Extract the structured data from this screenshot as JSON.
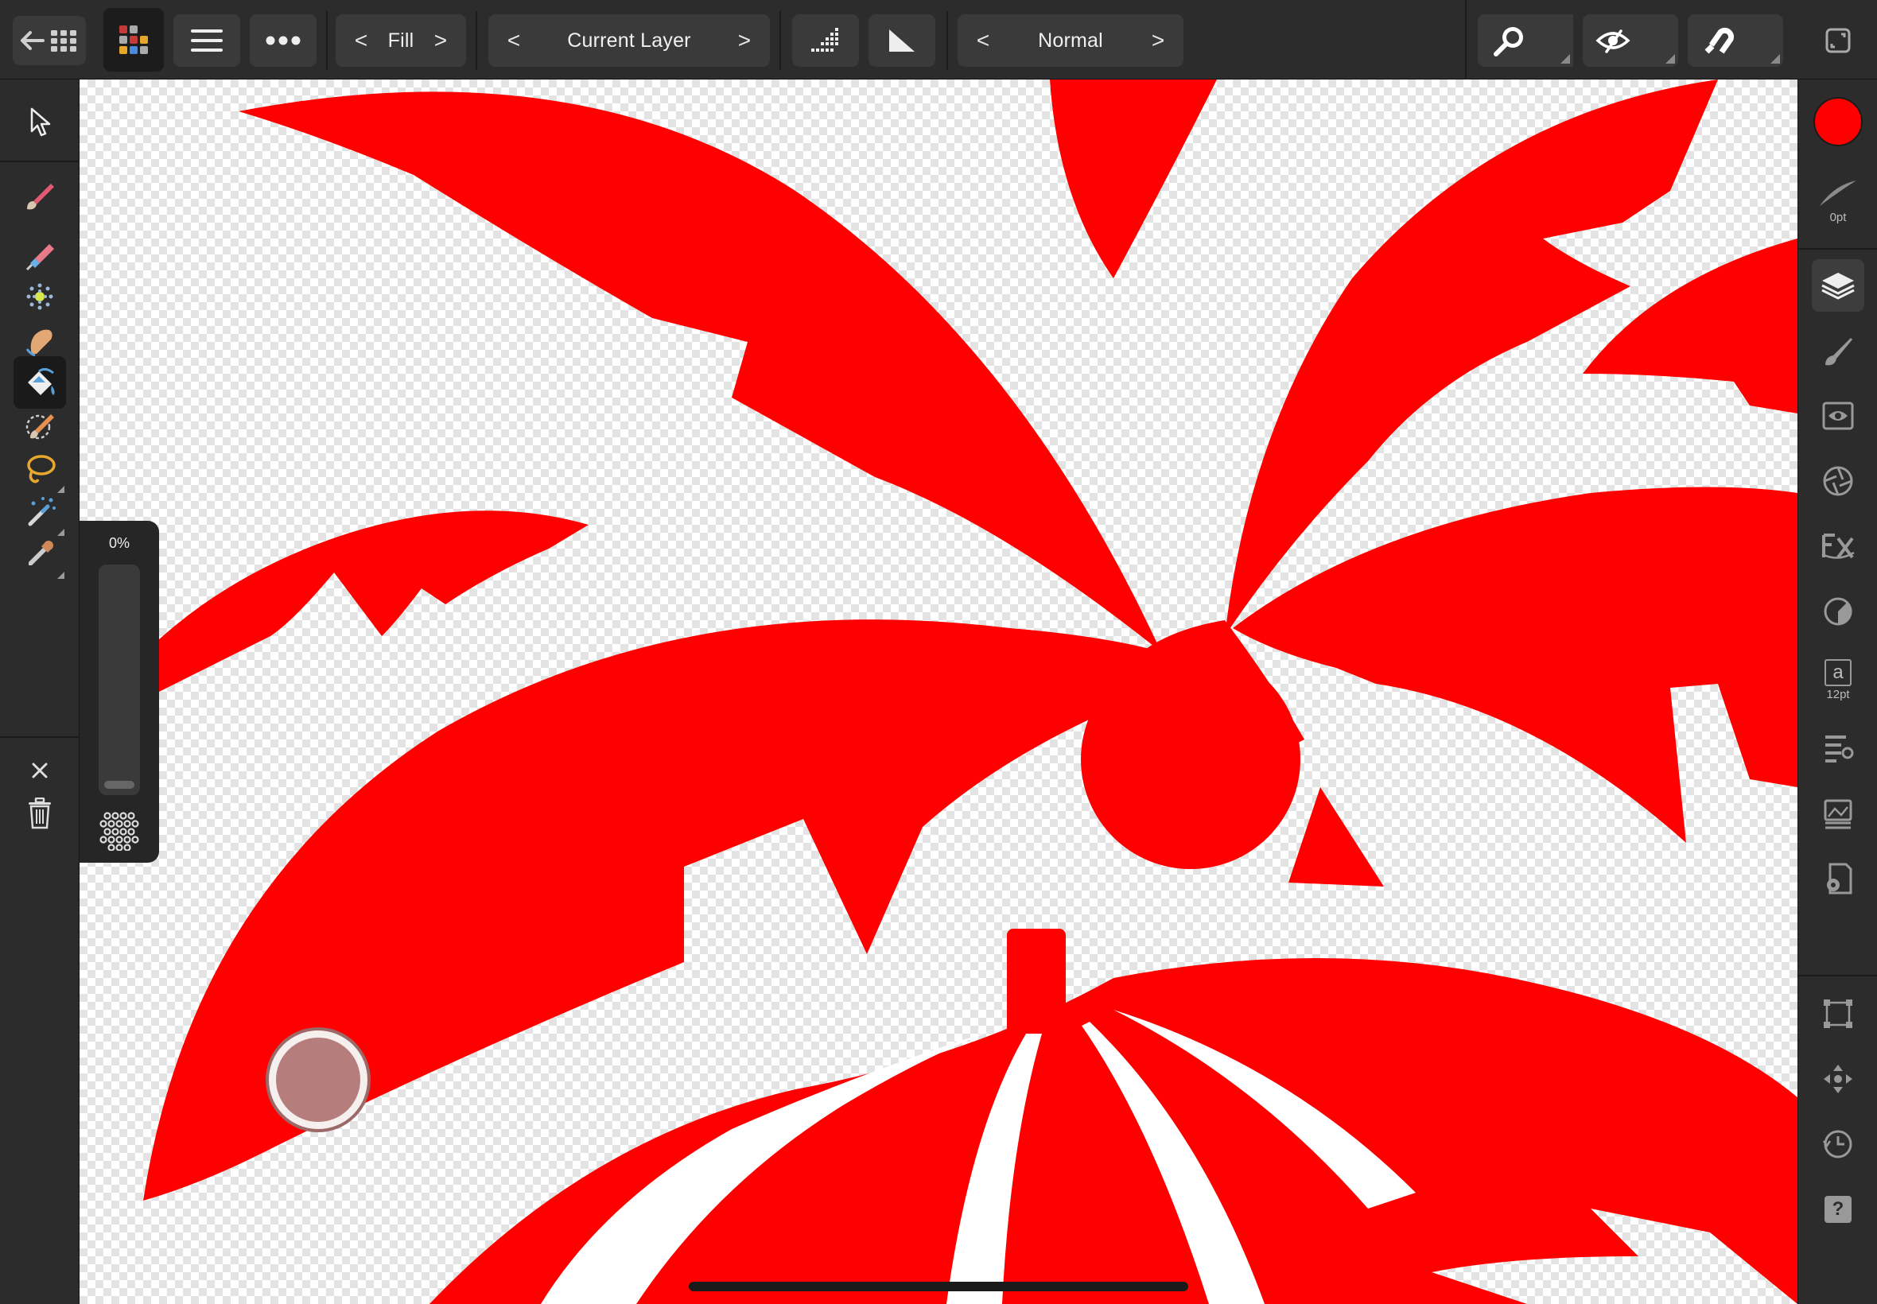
{
  "topbar": {
    "fill": {
      "label": "Fill",
      "prev": "<",
      "next": ">"
    },
    "source": {
      "label": "Current Layer",
      "prev": "<",
      "next": ">"
    },
    "blend": {
      "label": "Normal",
      "prev": "<",
      "next": ">"
    }
  },
  "opacity": {
    "value_label": "0%",
    "value": 0
  },
  "stroke": {
    "width_label": "0pt"
  },
  "text_tool": {
    "letter": "a",
    "size_label": "12pt"
  },
  "help": {
    "label": "?"
  },
  "colors": {
    "primary": "#ff0000",
    "canvas_art": "#ff0000",
    "assistant_dot": "#b57d7b",
    "ui_bg": "#2c2c2c"
  }
}
